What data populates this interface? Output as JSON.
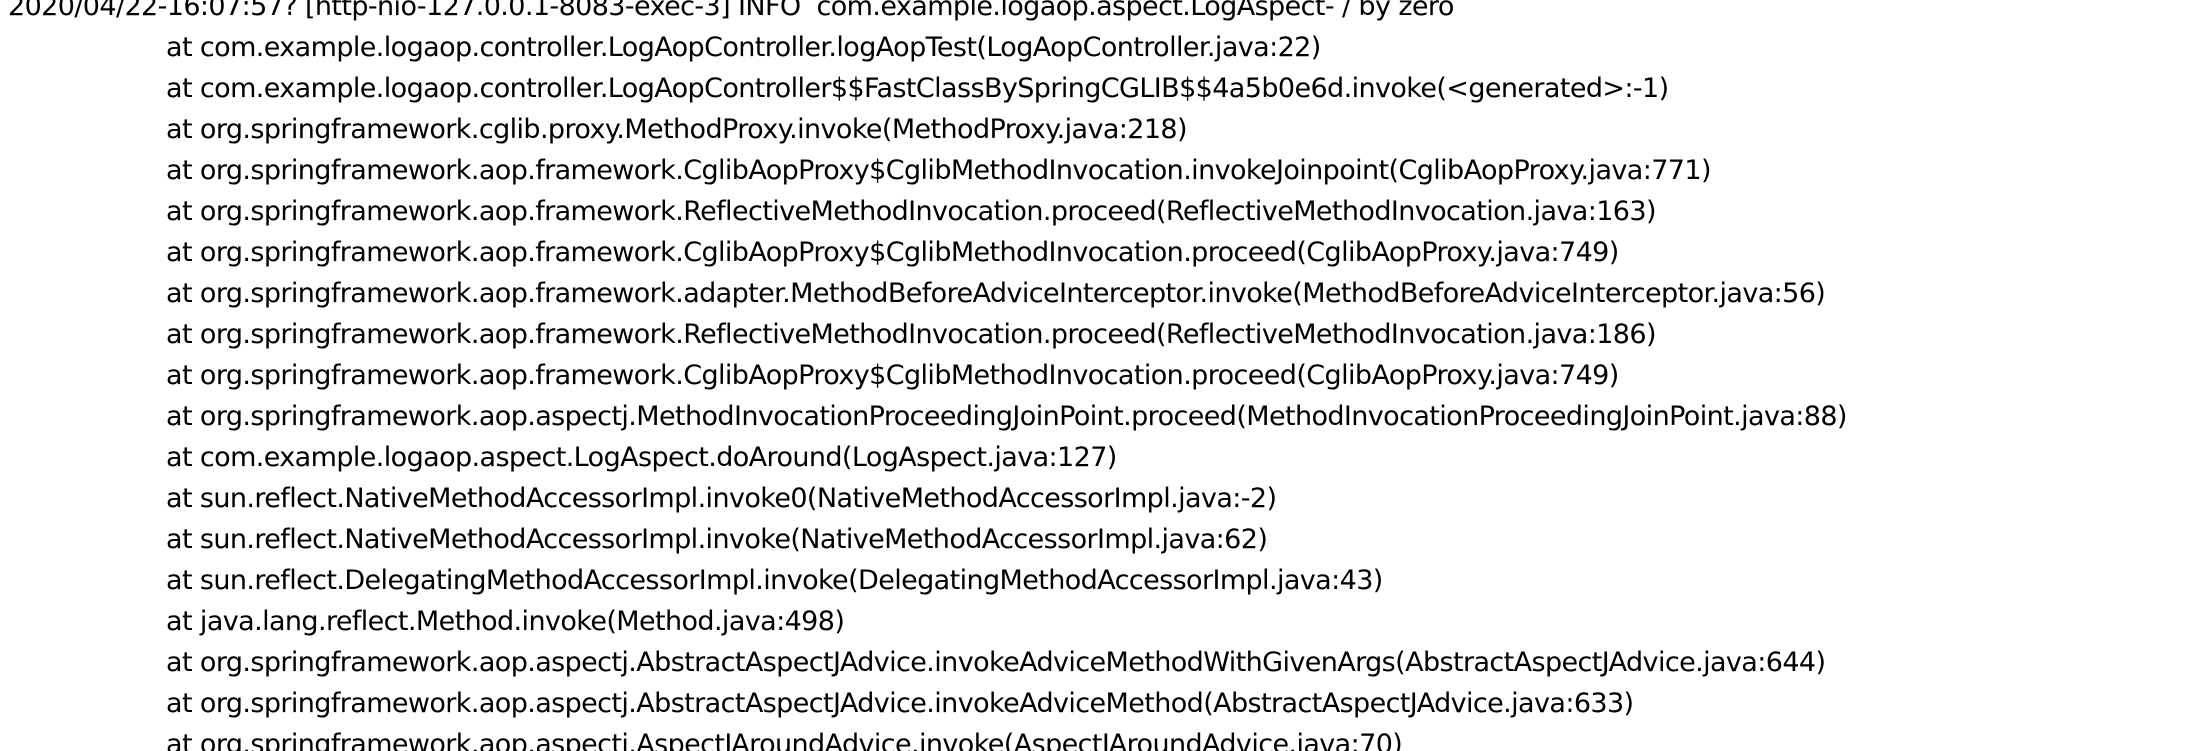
{
  "log": {
    "header": "2020/04/22-16:07:57? [http-nio-127.0.0.1-8083-exec-3] INFO  com.example.logaop.aspect.LogAspect- / by zero",
    "frames": [
      "at com.example.logaop.controller.LogAopController.logAopTest(LogAopController.java:22)",
      "at com.example.logaop.controller.LogAopController$$FastClassBySpringCGLIB$$4a5b0e6d.invoke(<generated>:-1)",
      "at org.springframework.cglib.proxy.MethodProxy.invoke(MethodProxy.java:218)",
      "at org.springframework.aop.framework.CglibAopProxy$CglibMethodInvocation.invokeJoinpoint(CglibAopProxy.java:771)",
      "at org.springframework.aop.framework.ReflectiveMethodInvocation.proceed(ReflectiveMethodInvocation.java:163)",
      "at org.springframework.aop.framework.CglibAopProxy$CglibMethodInvocation.proceed(CglibAopProxy.java:749)",
      "at org.springframework.aop.framework.adapter.MethodBeforeAdviceInterceptor.invoke(MethodBeforeAdviceInterceptor.java:56)",
      "at org.springframework.aop.framework.ReflectiveMethodInvocation.proceed(ReflectiveMethodInvocation.java:186)",
      "at org.springframework.aop.framework.CglibAopProxy$CglibMethodInvocation.proceed(CglibAopProxy.java:749)",
      "at org.springframework.aop.aspectj.MethodInvocationProceedingJoinPoint.proceed(MethodInvocationProceedingJoinPoint.java:88)",
      "at com.example.logaop.aspect.LogAspect.doAround(LogAspect.java:127)",
      "at sun.reflect.NativeMethodAccessorImpl.invoke0(NativeMethodAccessorImpl.java:-2)",
      "at sun.reflect.NativeMethodAccessorImpl.invoke(NativeMethodAccessorImpl.java:62)",
      "at sun.reflect.DelegatingMethodAccessorImpl.invoke(DelegatingMethodAccessorImpl.java:43)",
      "at java.lang.reflect.Method.invoke(Method.java:498)",
      "at org.springframework.aop.aspectj.AbstractAspectJAdvice.invokeAdviceMethodWithGivenArgs(AbstractAspectJAdvice.java:644)",
      "at org.springframework.aop.aspectj.AbstractAspectJAdvice.invokeAdviceMethod(AbstractAspectJAdvice.java:633)",
      "at org.springframework.aop.aspectj.AspectJAroundAdvice.invoke(AspectJAroundAdvice.java:70)"
    ]
  }
}
